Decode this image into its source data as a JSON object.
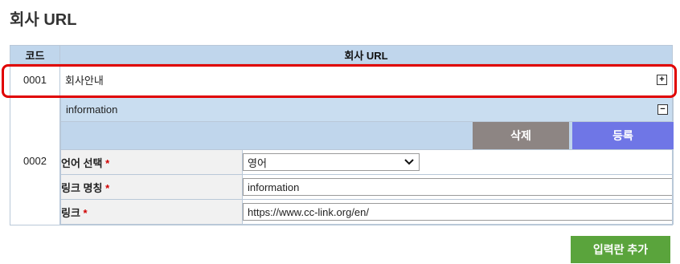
{
  "page": {
    "title": "회사 URL"
  },
  "table": {
    "col_code": "코드",
    "col_url": "회사 URL",
    "rows": [
      {
        "code": "0001",
        "name": "회사안내",
        "toggle": "+"
      },
      {
        "code": "0002",
        "name": "information",
        "toggle": "−"
      }
    ]
  },
  "detail": {
    "delete_label": "삭제",
    "register_label": "등록",
    "language_label": "언어 선택",
    "language_value": "영어",
    "link_name_label": "링크 명칭",
    "link_name_value": "information",
    "link_label": "링크",
    "link_value": "https://www.cc-link.org/en/",
    "required_mark": "*"
  },
  "footer": {
    "add_row_label": "입력란 추가"
  },
  "colors": {
    "header_bg": "#c0d6ec",
    "delete_bg": "#8d8583",
    "register_bg": "#6f76e6",
    "add_bg": "#5aa43c",
    "highlight": "#e00000"
  }
}
